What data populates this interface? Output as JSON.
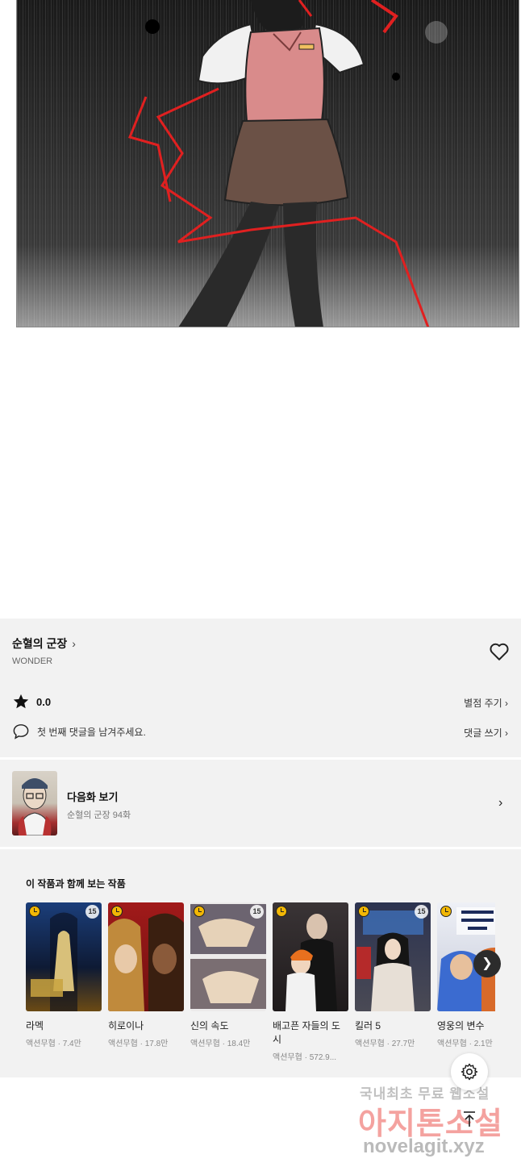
{
  "series": {
    "title": "순혈의 군장",
    "author": "WONDER",
    "rating": "0.0",
    "rate_link": "별점 주기",
    "comment_prompt": "첫 번째 댓글을 남겨주세요.",
    "comment_link": "댓글 쓰기"
  },
  "next_episode": {
    "label": "다음화 보기",
    "subtitle": "순혈의 군장 94화"
  },
  "recommendations": {
    "heading": "이 작품과 함께 보는 작품",
    "items": [
      {
        "title": "라멕",
        "genre": "액션무협",
        "views": "7.4만",
        "age": "15",
        "cover_color": "#15264a"
      },
      {
        "title": "히로이나",
        "genre": "액션무협",
        "views": "17.8만",
        "age": "",
        "cover_color": "#8a2222"
      },
      {
        "title": "신의 속도",
        "genre": "액션무협",
        "views": "18.4만",
        "age": "15",
        "cover_color": "#5d5560"
      },
      {
        "title": "배고픈 자들의 도시",
        "genre": "액션무협",
        "views": "572.9...",
        "age": "",
        "cover_color": "#2f2b2c"
      },
      {
        "title": "킬러 5",
        "genre": "액션무협",
        "views": "27.7만",
        "age": "15",
        "cover_color": "#3a3f52"
      },
      {
        "title": "영웅의 변수",
        "genre": "액션무협",
        "views": "2.1만",
        "age": "",
        "cover_color": "#d8d8e6"
      }
    ]
  },
  "watermark": {
    "line1": "국내최초 무료 웹소설",
    "line2": "아지톤소설",
    "line3": "novelagit.xyz"
  },
  "colors": {
    "panel_bg": "#f2f2f2",
    "star": "#111111",
    "clock_badge": "#f2b705"
  },
  "icons": [
    "heart-icon",
    "star-icon",
    "comment-icon",
    "chevron-right-icon",
    "gear-icon",
    "arrow-up-icon",
    "clock-icon"
  ]
}
